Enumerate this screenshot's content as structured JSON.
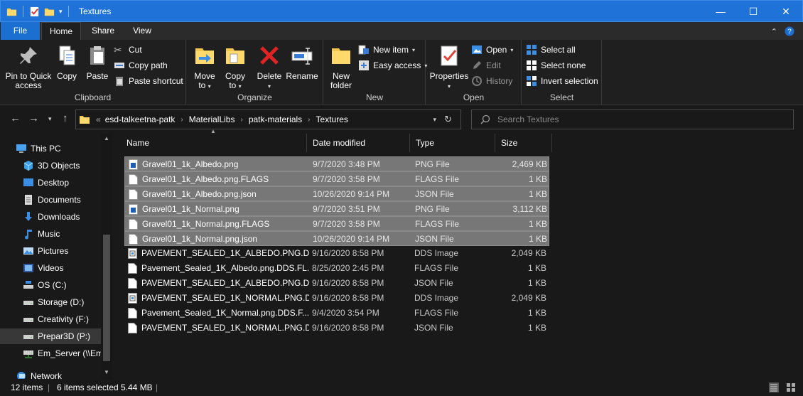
{
  "window": {
    "title": "Textures",
    "minimize_glyph": "—",
    "maximize_glyph": "☐",
    "close_glyph": "✕"
  },
  "ribbon_tabs": [
    "File",
    "Home",
    "Share",
    "View"
  ],
  "ribbon": {
    "clipboard": {
      "label": "Clipboard",
      "pin_label": "Pin to Quick access",
      "copy_label": "Copy",
      "paste_label": "Paste",
      "cut_label": "Cut",
      "copy_path_label": "Copy path",
      "paste_shortcut_label": "Paste shortcut"
    },
    "organize": {
      "label": "Organize",
      "move_to_label": "Move to",
      "copy_to_label": "Copy to",
      "delete_label": "Delete",
      "rename_label": "Rename"
    },
    "new": {
      "label": "New",
      "new_folder_label": "New folder",
      "new_item_label": "New item",
      "easy_access_label": "Easy access"
    },
    "open": {
      "label": "Open",
      "properties_label": "Properties",
      "open_label": "Open",
      "edit_label": "Edit",
      "history_label": "History"
    },
    "select": {
      "label": "Select",
      "select_all_label": "Select all",
      "select_none_label": "Select none",
      "invert_label": "Invert selection"
    }
  },
  "address": {
    "overflow": "«",
    "crumbs": [
      "esd-talkeetna-patk",
      "MaterialLibs",
      "patk-materials",
      "Textures"
    ],
    "search_placeholder": "Search Textures"
  },
  "nav": {
    "items": [
      {
        "label": "This PC",
        "icon": "computer-icon"
      },
      {
        "label": "3D Objects",
        "icon": "cube-icon"
      },
      {
        "label": "Desktop",
        "icon": "desktop-icon"
      },
      {
        "label": "Documents",
        "icon": "document-icon"
      },
      {
        "label": "Downloads",
        "icon": "download-icon"
      },
      {
        "label": "Music",
        "icon": "music-icon"
      },
      {
        "label": "Pictures",
        "icon": "pictures-icon"
      },
      {
        "label": "Videos",
        "icon": "video-icon"
      },
      {
        "label": "OS (C:)",
        "icon": "os-drive-icon"
      },
      {
        "label": "Storage (D:)",
        "icon": "drive-icon"
      },
      {
        "label": "Creativity (F:)",
        "icon": "drive-icon"
      },
      {
        "label": "Prepar3D (P:)",
        "icon": "drive-icon"
      },
      {
        "label": "Em_Server (\\\\Em",
        "icon": "network-drive-icon"
      },
      {
        "label": "Network",
        "icon": "network-icon"
      }
    ]
  },
  "columns": {
    "name": "Name",
    "date": "Date modified",
    "type": "Type",
    "size": "Size"
  },
  "files": [
    {
      "name": "Gravel01_1k_Albedo.png",
      "date": "9/7/2020 3:48 PM",
      "type": "PNG File",
      "size": "2,469 KB",
      "selected": true,
      "icon": "image-file-icon"
    },
    {
      "name": "Gravel01_1k_Albedo.png.FLAGS",
      "date": "9/7/2020 3:58 PM",
      "type": "FLAGS File",
      "size": "1 KB",
      "selected": true,
      "icon": "file-icon"
    },
    {
      "name": "Gravel01_1k_Albedo.png.json",
      "date": "10/26/2020 9:14 PM",
      "type": "JSON File",
      "size": "1 KB",
      "selected": true,
      "icon": "file-icon"
    },
    {
      "name": "Gravel01_1k_Normal.png",
      "date": "9/7/2020 3:51 PM",
      "type": "PNG File",
      "size": "3,112 KB",
      "selected": true,
      "icon": "image-file-icon"
    },
    {
      "name": "Gravel01_1k_Normal.png.FLAGS",
      "date": "9/7/2020 3:58 PM",
      "type": "FLAGS File",
      "size": "1 KB",
      "selected": true,
      "icon": "file-icon"
    },
    {
      "name": "Gravel01_1k_Normal.png.json",
      "date": "10/26/2020 9:14 PM",
      "type": "JSON File",
      "size": "1 KB",
      "selected": true,
      "icon": "file-icon"
    },
    {
      "name": "PAVEMENT_SEALED_1K_ALBEDO.PNG.DDS",
      "date": "9/16/2020 8:58 PM",
      "type": "DDS Image",
      "size": "2,049 KB",
      "selected": false,
      "icon": "dds-file-icon"
    },
    {
      "name": "Pavement_Sealed_1K_Albedo.png.DDS.FL...",
      "date": "8/25/2020 2:45 PM",
      "type": "FLAGS File",
      "size": "1 KB",
      "selected": false,
      "icon": "file-icon"
    },
    {
      "name": "PAVEMENT_SEALED_1K_ALBEDO.PNG.DD...",
      "date": "9/16/2020 8:58 PM",
      "type": "JSON File",
      "size": "1 KB",
      "selected": false,
      "icon": "file-icon"
    },
    {
      "name": "PAVEMENT_SEALED_1K_NORMAL.PNG.D...",
      "date": "9/16/2020 8:58 PM",
      "type": "DDS Image",
      "size": "2,049 KB",
      "selected": false,
      "icon": "dds-file-icon"
    },
    {
      "name": "Pavement_Sealed_1K_Normal.png.DDS.F...",
      "date": "9/4/2020 3:54 PM",
      "type": "FLAGS File",
      "size": "1 KB",
      "selected": false,
      "icon": "file-icon"
    },
    {
      "name": "PAVEMENT_SEALED_1K_NORMAL.PNG.DD...",
      "date": "9/16/2020 8:58 PM",
      "type": "JSON File",
      "size": "1 KB",
      "selected": false,
      "icon": "file-icon"
    }
  ],
  "status": {
    "count": "12 items",
    "selected": "6 items selected",
    "size": "5.44 MB"
  },
  "colors": {
    "titlebar": "#1e72d8",
    "file_tab": "#1a6fd1",
    "selection": "#777777",
    "background": "#191919"
  }
}
